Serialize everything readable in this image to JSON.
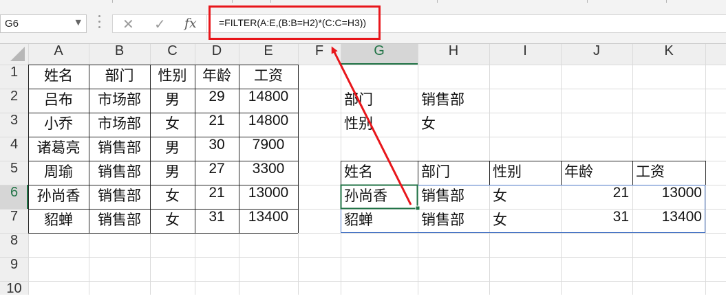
{
  "name_box": {
    "value": "G6"
  },
  "formula_bar": {
    "formula": "=FILTER(A:E,(B:B=H2)*(C:C=H3))",
    "cancel_icon": "✕",
    "enter_icon": "✓",
    "fx_label": "fx"
  },
  "columns": [
    "A",
    "B",
    "C",
    "D",
    "E",
    "F",
    "G",
    "H",
    "I",
    "J",
    "K"
  ],
  "rows": [
    "1",
    "2",
    "3",
    "4",
    "5",
    "6",
    "7",
    "8",
    "9",
    "10"
  ],
  "source_table": {
    "headers": [
      "姓名",
      "部门",
      "性别",
      "年龄",
      "工资"
    ],
    "rows": [
      [
        "吕布",
        "市场部",
        "男",
        "29",
        "14800"
      ],
      [
        "小乔",
        "市场部",
        "女",
        "21",
        "14800"
      ],
      [
        "诸葛亮",
        "销售部",
        "男",
        "30",
        "7900"
      ],
      [
        "周瑜",
        "销售部",
        "男",
        "27",
        "3300"
      ],
      [
        "孙尚香",
        "销售部",
        "女",
        "21",
        "13000"
      ],
      [
        "貂蝉",
        "销售部",
        "女",
        "31",
        "13400"
      ]
    ]
  },
  "criteria": {
    "dept_label": "部门",
    "dept_value": "销售部",
    "gender_label": "性别",
    "gender_value": "女"
  },
  "result_table": {
    "headers": [
      "姓名",
      "部门",
      "性别",
      "年龄",
      "工资"
    ],
    "rows": [
      [
        "孙尚香",
        "销售部",
        "女",
        "21",
        "13000"
      ],
      [
        "貂蝉",
        "销售部",
        "女",
        "31",
        "13400"
      ]
    ]
  },
  "colors": {
    "highlight": "#e8161b",
    "selection": "#217346",
    "spill_border": "#4472c4"
  }
}
